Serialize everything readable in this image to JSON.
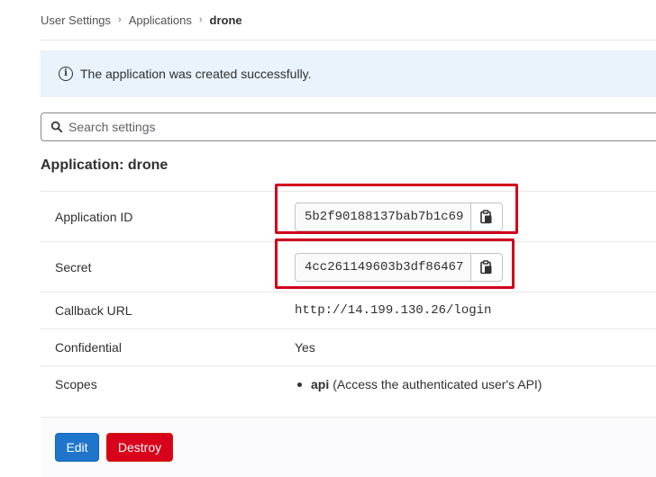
{
  "breadcrumb": {
    "items": [
      "User Settings",
      "Applications"
    ],
    "current": "drone",
    "separator": "›"
  },
  "alert": {
    "icon": "info-icon",
    "message": "The application was created successfully."
  },
  "search": {
    "placeholder": "Search settings",
    "icon": "search-icon"
  },
  "application": {
    "title": "Application: drone",
    "fields": {
      "app_id_label": "Application ID",
      "app_id_value": "5b2f90188137bab7b1c69",
      "secret_label": "Secret",
      "secret_value": "4cc261149603b3df86467",
      "callback_label": "Callback URL",
      "callback_value": "http://14.199.130.26/login",
      "confidential_label": "Confidential",
      "confidential_value": "Yes",
      "scopes_label": "Scopes",
      "scope_name": "api",
      "scope_desc": "(Access the authenticated user's API)"
    },
    "copy_icon": "clipboard-icon"
  },
  "actions": {
    "edit_label": "Edit",
    "destroy_label": "Destroy"
  },
  "colors": {
    "alert_bg": "#e9f3fc",
    "edit_button": "#1f75cb",
    "destroy_button": "#d9001b",
    "highlight": "#d0021b"
  }
}
